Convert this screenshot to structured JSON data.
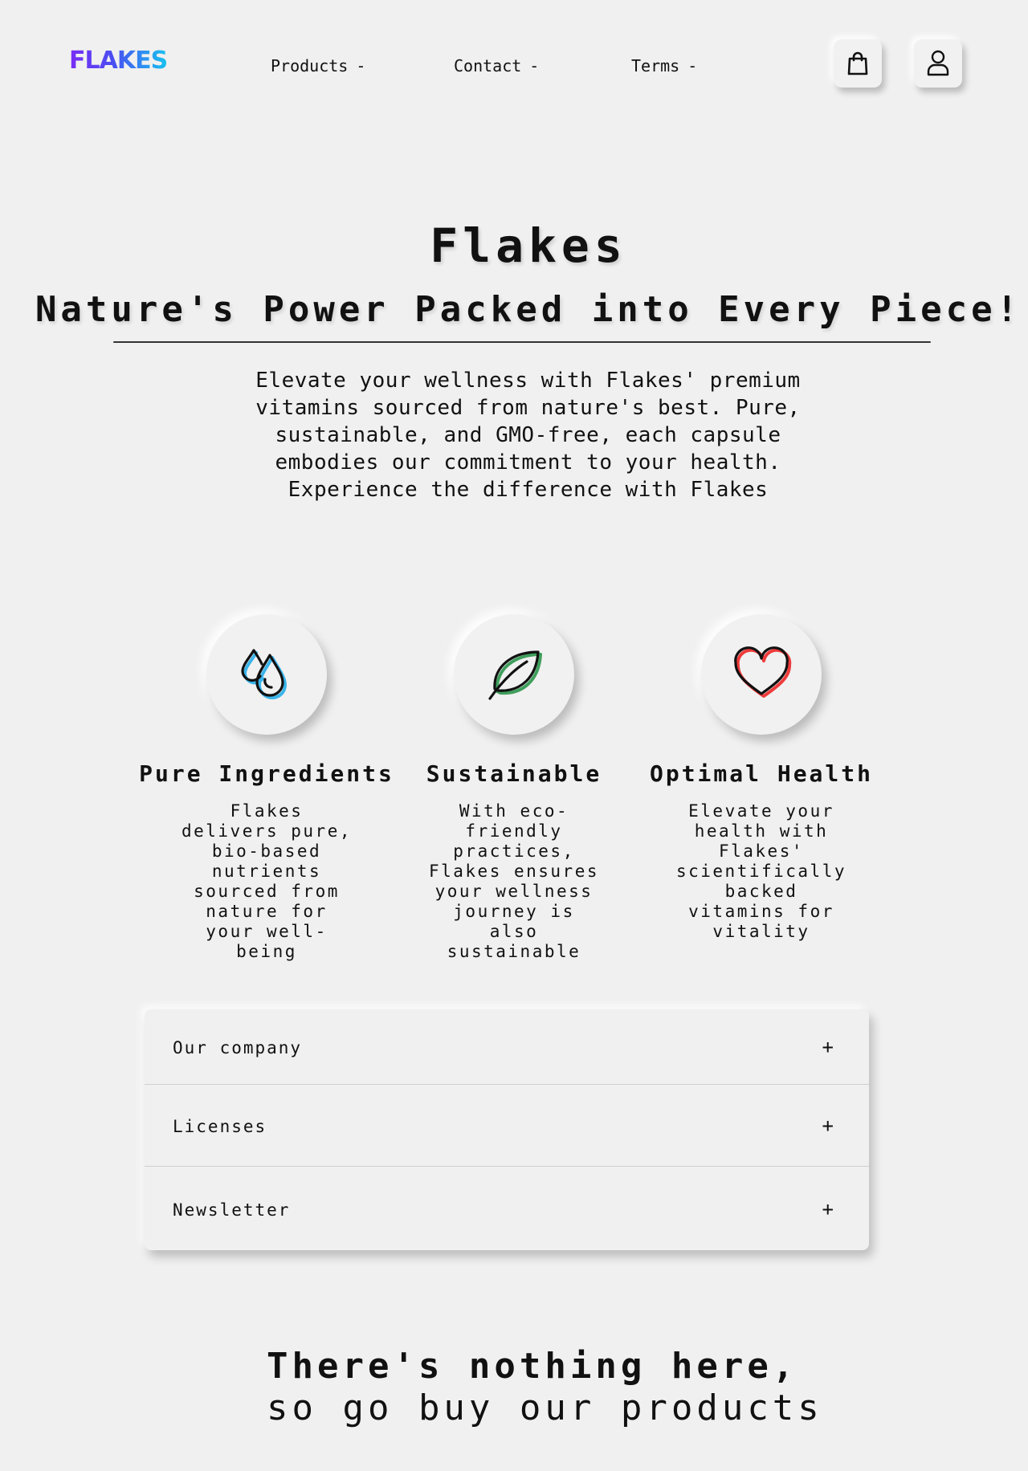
{
  "header": {
    "logo": "FLAKES",
    "nav": [
      {
        "label": "Products",
        "caret": "-"
      },
      {
        "label": "Contact",
        "caret": "-"
      },
      {
        "label": "Terms",
        "caret": "-"
      }
    ],
    "icons": [
      "shopping-bag-icon",
      "user-icon"
    ]
  },
  "hero": {
    "title": "Flakes",
    "subtitle": "Nature's Power Packed into Every Piece!",
    "description": "Elevate your wellness with Flakes' premium vitamins sourced from nature's best. Pure, sustainable, and GMO-free, each capsule embodies our commitment to your health. Experience the difference with Flakes"
  },
  "features": [
    {
      "icon": "water-drops-icon",
      "title": "Pure Ingredients",
      "description": "Flakes delivers pure, bio-based nutrients sourced from nature for your well-being",
      "accent": "#3ab4ea"
    },
    {
      "icon": "leaf-icon",
      "title": "Sustainable",
      "description": "With eco-friendly practices, Flakes ensures your wellness journey is also sustainable",
      "accent": "#3f9e5c"
    },
    {
      "icon": "heart-icon",
      "title": "Optimal Health",
      "description": "Elevate your health with Flakes' scientifically backed vitamins for vitality",
      "accent": "#ee3b3b"
    }
  ],
  "accordion": [
    {
      "label": "Our company",
      "toggle": "+"
    },
    {
      "label": "Licenses",
      "toggle": "+"
    },
    {
      "label": "Newsletter",
      "toggle": "+"
    }
  ],
  "tagline": {
    "line1": "There's nothing here,",
    "line2": "so go buy our products"
  },
  "colors": {
    "background": "#f0f0f0",
    "logo_gradient_start": "#7a2cf5",
    "logo_gradient_end": "#18c2f0"
  }
}
